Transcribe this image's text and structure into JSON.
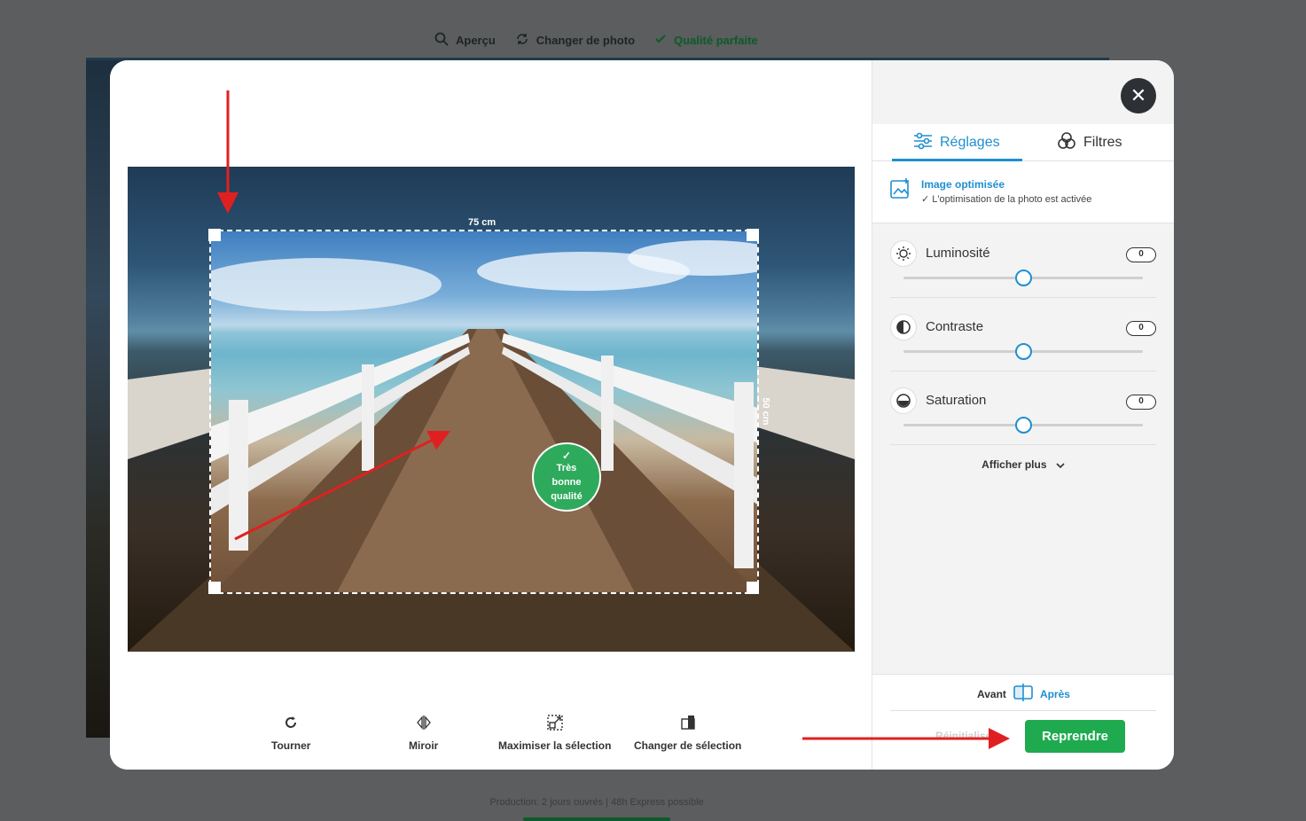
{
  "background": {
    "toolbar": [
      {
        "icon": "magnifier-icon",
        "label": "Aperçu"
      },
      {
        "icon": "refresh-icon",
        "label": "Changer de photo"
      },
      {
        "icon": "check-icon",
        "label": "Qualité parfaite"
      }
    ],
    "footer_text": "Production: 2 jours ouvrés | 48h Express possible"
  },
  "editor": {
    "crop_width_label": "75 cm",
    "crop_height_label": "50 cm",
    "quality_badge": {
      "line1": "Très",
      "line2": "bonne",
      "line3": "qualité"
    },
    "tools": [
      {
        "icon": "rotate-icon",
        "label": "Tourner"
      },
      {
        "icon": "mirror-icon",
        "label": "Miroir"
      },
      {
        "icon": "maximize-selection-icon",
        "label": "Maximiser la sélection"
      },
      {
        "icon": "change-selection-icon",
        "label": "Changer de sélection"
      }
    ]
  },
  "sidebar": {
    "close_icon": "close-icon",
    "tabs": [
      {
        "icon": "sliders-icon",
        "label": "Réglages",
        "active": true
      },
      {
        "icon": "filters-icon",
        "label": "Filtres",
        "active": false
      }
    ],
    "optimization": {
      "title": "Image optimisée",
      "subtitle": "✓ L'optimisation de la photo est activée"
    },
    "adjustments": [
      {
        "icon": "sun-icon",
        "label": "Luminosité",
        "value": "0",
        "level": 0.5
      },
      {
        "icon": "contrast-icon",
        "label": "Contraste",
        "value": "0",
        "level": 0.5
      },
      {
        "icon": "saturation-icon",
        "label": "Saturation",
        "value": "0",
        "level": 0.5
      }
    ],
    "show_more": "Afficher plus",
    "before_label": "Avant",
    "after_label": "Après",
    "reset_label": "Réinitialiser",
    "resume_label": "Reprendre"
  },
  "colors": {
    "accent": "#1f8fd0",
    "primary_button": "#1faa4f",
    "quality_badge": "#2eaa5c",
    "annotation": "#e02020"
  }
}
